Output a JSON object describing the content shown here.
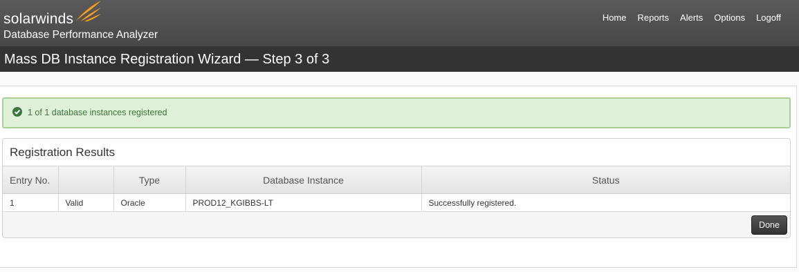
{
  "header": {
    "brand": "solarwinds",
    "product": "Database Performance Analyzer",
    "nav": [
      "Home",
      "Reports",
      "Alerts",
      "Options",
      "Logoff"
    ]
  },
  "page": {
    "title": "Mass DB Instance Registration Wizard — Step 3 of 3"
  },
  "alert": {
    "icon": "check-circle-icon",
    "text": "1 of 1 database instances registered",
    "color": "#3c763d"
  },
  "results": {
    "title": "Registration Results",
    "columns": [
      "Entry No.",
      "",
      "Type",
      "Database Instance",
      "Status"
    ],
    "rows": [
      {
        "entry": "1",
        "validity": "Valid",
        "type": "Oracle",
        "instance": "PROD12_KGIBBS-LT",
        "status": "Successfully registered."
      }
    ],
    "done_label": "Done"
  },
  "colors": {
    "brand_orange": "#f99d1c",
    "header_bg": "#4f4f4f",
    "titlebar_bg": "#333333"
  }
}
